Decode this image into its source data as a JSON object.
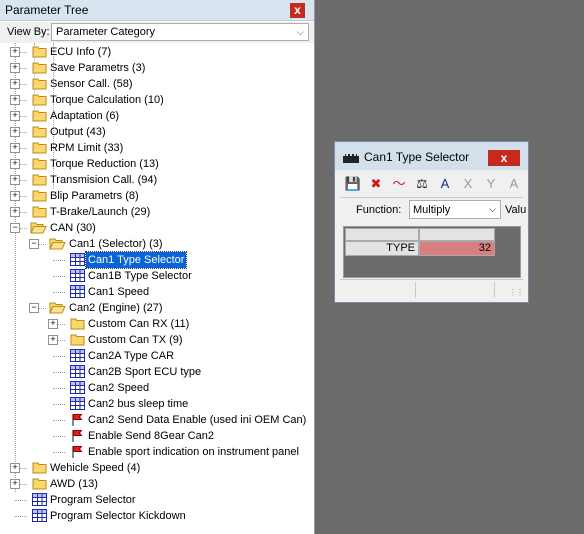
{
  "panel": {
    "title": "Parameter Tree",
    "close_label": "x",
    "view_by_label": "View By:",
    "view_by_value": "Parameter Category"
  },
  "tree": [
    {
      "label": "ECU Info (7)",
      "level": 0,
      "icon": "folder",
      "expander": "plus"
    },
    {
      "label": "Save Parametrs (3)",
      "level": 0,
      "icon": "folder",
      "expander": "plus"
    },
    {
      "label": "Sensor Call. (58)",
      "level": 0,
      "icon": "folder",
      "expander": "plus"
    },
    {
      "label": "Torque Calculation (10)",
      "level": 0,
      "icon": "folder",
      "expander": "plus"
    },
    {
      "label": "Adaptation (6)",
      "level": 0,
      "icon": "folder",
      "expander": "plus"
    },
    {
      "label": "Output (43)",
      "level": 0,
      "icon": "folder",
      "expander": "plus"
    },
    {
      "label": "RPM Limit (33)",
      "level": 0,
      "icon": "folder",
      "expander": "plus"
    },
    {
      "label": "Torque Reduction (13)",
      "level": 0,
      "icon": "folder",
      "expander": "plus"
    },
    {
      "label": "Transmision Call. (94)",
      "level": 0,
      "icon": "folder",
      "expander": "plus"
    },
    {
      "label": "Blip Parametrs (8)",
      "level": 0,
      "icon": "folder",
      "expander": "plus"
    },
    {
      "label": "T-Brake/Launch (29)",
      "level": 0,
      "icon": "folder",
      "expander": "plus"
    },
    {
      "label": "CAN (30)",
      "level": 0,
      "icon": "folder-open",
      "expander": "minus"
    },
    {
      "label": "Can1 (Selector) (3)",
      "level": 1,
      "icon": "folder-open",
      "expander": "minus"
    },
    {
      "label": "Can1 Type Selector",
      "level": 2,
      "icon": "table",
      "expander": "",
      "selected": true
    },
    {
      "label": "Can1B Type Selector",
      "level": 2,
      "icon": "table",
      "expander": ""
    },
    {
      "label": "Can1 Speed",
      "level": 2,
      "icon": "table",
      "expander": ""
    },
    {
      "label": "Can2 (Engine) (27)",
      "level": 1,
      "icon": "folder-open",
      "expander": "minus"
    },
    {
      "label": "Custom Can RX (11)",
      "level": 2,
      "icon": "folder",
      "expander": "plus"
    },
    {
      "label": "Custom Can TX (9)",
      "level": 2,
      "icon": "folder",
      "expander": "plus"
    },
    {
      "label": "Can2A Type CAR",
      "level": 2,
      "icon": "table",
      "expander": ""
    },
    {
      "label": "Can2B Sport ECU type",
      "level": 2,
      "icon": "table",
      "expander": ""
    },
    {
      "label": "Can2 Speed",
      "level": 2,
      "icon": "table",
      "expander": ""
    },
    {
      "label": "Can2 bus sleep time",
      "level": 2,
      "icon": "table",
      "expander": ""
    },
    {
      "label": "Can2 Send Data Enable (used ini OEM Can)",
      "level": 2,
      "icon": "flag",
      "expander": ""
    },
    {
      "label": "Enable Send 8Gear Can2",
      "level": 2,
      "icon": "flag",
      "expander": ""
    },
    {
      "label": "Enable sport indication on instrument panel",
      "level": 2,
      "icon": "flag",
      "expander": ""
    },
    {
      "label": "Wehicle Speed (4)",
      "level": 0,
      "icon": "folder",
      "expander": "plus"
    },
    {
      "label": "AWD (13)",
      "level": 0,
      "icon": "folder",
      "expander": "plus"
    },
    {
      "label": "Program Selector",
      "level": 0,
      "icon": "table",
      "expander": ""
    },
    {
      "label": "Program Selector Kickdown",
      "level": 0,
      "icon": "table",
      "expander": ""
    }
  ],
  "window": {
    "title": "Can1 Type Selector",
    "close_label": "x",
    "toolbar": [
      {
        "name": "save-icon",
        "glyph": "💾",
        "color": "#1b2c5a"
      },
      {
        "name": "delete-icon",
        "glyph": "✖",
        "color": "#d01818"
      },
      {
        "name": "chart-icon",
        "glyph": "〜",
        "color": "#d01818"
      },
      {
        "name": "balance-icon",
        "glyph": "⚖",
        "color": "#222222"
      },
      {
        "name": "triangle-a-icon",
        "glyph": "A",
        "color": "#1b2c8a"
      },
      {
        "name": "triangle-x-icon",
        "glyph": "X",
        "color": "#9a9a9a"
      },
      {
        "name": "y-arrow-icon",
        "glyph": "Y",
        "color": "#9a9a9a"
      },
      {
        "name": "a-icon",
        "glyph": "A",
        "color": "#9a9a9a"
      }
    ],
    "function_label": "Function:",
    "function_value": "Multiply",
    "value_label_partial": "Valu",
    "table": {
      "row_label": "TYPE",
      "value": "32",
      "value_bg": "#d88080"
    }
  }
}
